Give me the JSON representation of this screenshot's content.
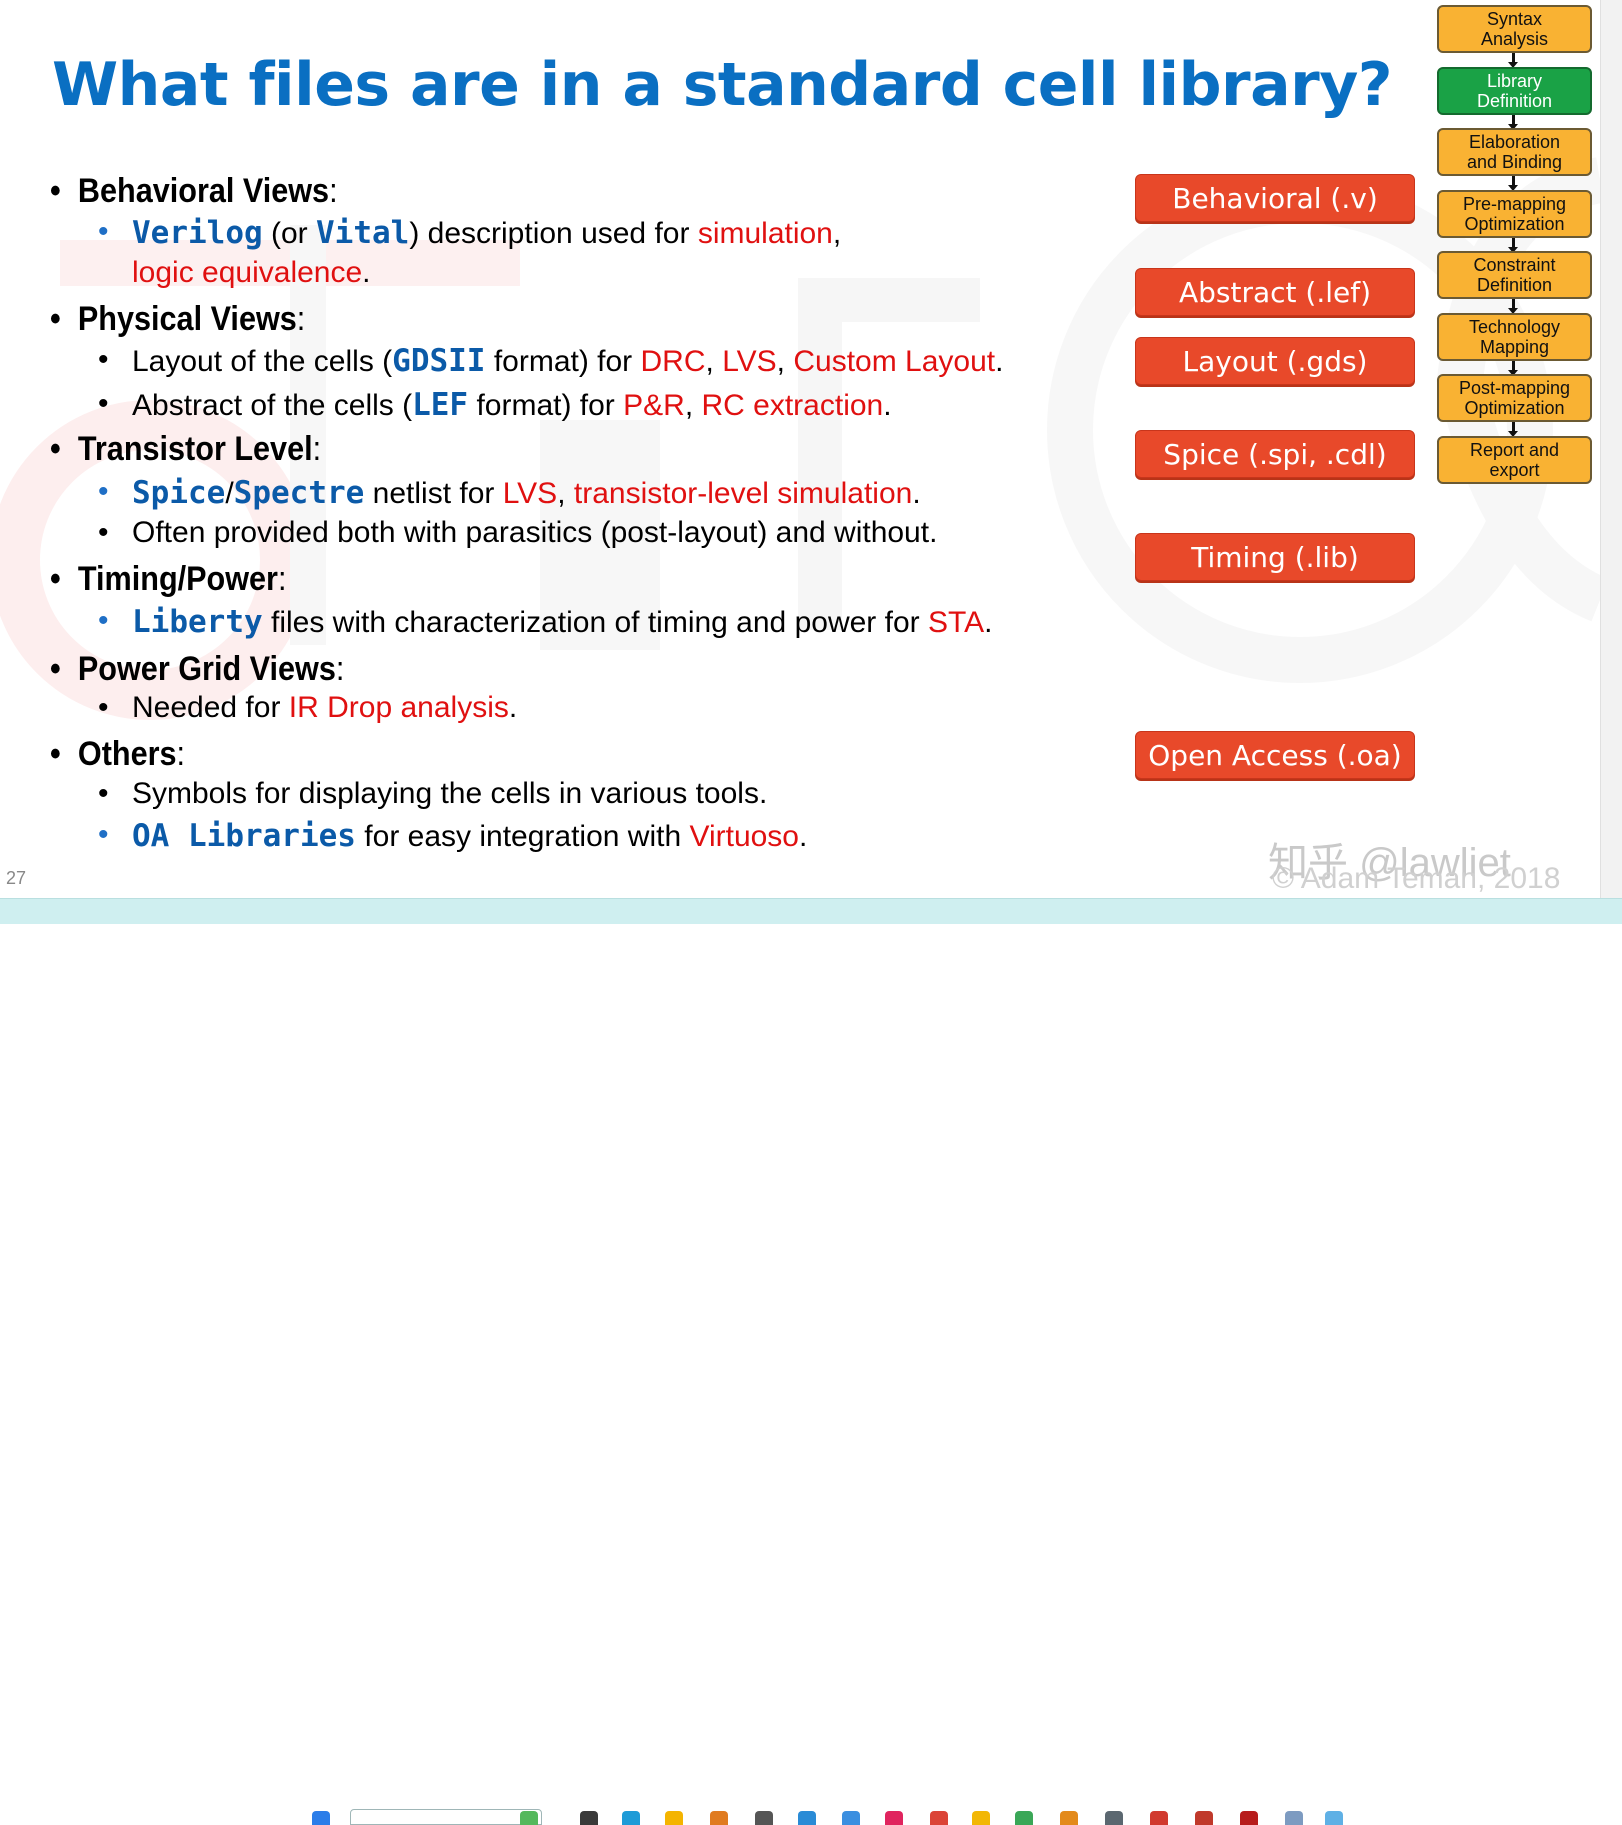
{
  "slide": {
    "title": "What files are in a standard cell library?",
    "bullets": [
      {
        "heading_text": "Behavioral Views",
        "heading_colon": ":",
        "subs": [
          {
            "bullet_blue": true,
            "runs": [
              {
                "text": "Verilog",
                "style": "mono"
              },
              {
                "text": " (or ",
                "style": "plain"
              },
              {
                "text": "Vital",
                "style": "mono"
              },
              {
                "text": ") description used for ",
                "style": "plain"
              },
              {
                "text": "simulation",
                "style": "red"
              },
              {
                "text": ",",
                "style": "plain"
              }
            ]
          },
          {
            "bullet_blue": false,
            "continuation": true,
            "runs": [
              {
                "text": "logic equivalence",
                "style": "red"
              },
              {
                "text": ".",
                "style": "plain"
              }
            ]
          }
        ]
      },
      {
        "heading_text": "Physical Views",
        "heading_colon": ":",
        "subs": [
          {
            "bullet_blue": false,
            "runs": [
              {
                "text": "Layout of the cells (",
                "style": "plain"
              },
              {
                "text": "GDSII",
                "style": "mono"
              },
              {
                "text": " format) for ",
                "style": "plain"
              },
              {
                "text": "DRC",
                "style": "red"
              },
              {
                "text": ", ",
                "style": "plain"
              },
              {
                "text": "LVS",
                "style": "red"
              },
              {
                "text": ", ",
                "style": "plain"
              },
              {
                "text": "Custom Layout",
                "style": "red"
              },
              {
                "text": ".",
                "style": "plain"
              }
            ]
          },
          {
            "bullet_blue": false,
            "runs": [
              {
                "text": "Abstract of the cells (",
                "style": "plain"
              },
              {
                "text": "LEF",
                "style": "mono"
              },
              {
                "text": " format) for ",
                "style": "plain"
              },
              {
                "text": "P&R",
                "style": "red"
              },
              {
                "text": ", ",
                "style": "plain"
              },
              {
                "text": "RC extraction",
                "style": "red"
              },
              {
                "text": ".",
                "style": "plain"
              }
            ]
          }
        ]
      },
      {
        "heading_text": "Transistor Level",
        "heading_colon": ":",
        "subs": [
          {
            "bullet_blue": true,
            "runs": [
              {
                "text": "Spice",
                "style": "mono"
              },
              {
                "text": "/",
                "style": "plain"
              },
              {
                "text": "Spectre",
                "style": "mono"
              },
              {
                "text": " netlist for ",
                "style": "plain"
              },
              {
                "text": "LVS",
                "style": "red"
              },
              {
                "text": ", ",
                "style": "plain"
              },
              {
                "text": "transistor-level simulation",
                "style": "red"
              },
              {
                "text": ".",
                "style": "plain"
              }
            ]
          },
          {
            "bullet_blue": false,
            "runs": [
              {
                "text": "Often provided both with parasitics (post-layout) and without.",
                "style": "plain"
              }
            ]
          }
        ]
      },
      {
        "heading_text": "Timing/Power",
        "heading_colon": ":",
        "subs": [
          {
            "bullet_blue": true,
            "runs": [
              {
                "text": "Liberty",
                "style": "mono"
              },
              {
                "text": " files with characterization of timing and power for ",
                "style": "plain"
              },
              {
                "text": "STA",
                "style": "red"
              },
              {
                "text": ".",
                "style": "plain"
              }
            ]
          }
        ]
      },
      {
        "heading_text": "Power Grid Views",
        "heading_colon": ":",
        "subs": [
          {
            "bullet_blue": false,
            "runs": [
              {
                "text": "Needed for ",
                "style": "plain"
              },
              {
                "text": "IR Drop analysis",
                "style": "red"
              },
              {
                "text": ".",
                "style": "plain"
              }
            ]
          }
        ]
      },
      {
        "heading_text": "Others",
        "heading_colon": ":",
        "subs": [
          {
            "bullet_blue": false,
            "runs": [
              {
                "text": "Symbols for displaying the cells in various tools.",
                "style": "plain"
              }
            ]
          },
          {
            "bullet_blue": true,
            "runs": [
              {
                "text": "OA Libraries",
                "style": "mono"
              },
              {
                "text": " for easy integration with ",
                "style": "plain"
              },
              {
                "text": "Virtuoso",
                "style": "red"
              },
              {
                "text": ".",
                "style": "plain"
              }
            ]
          }
        ]
      }
    ],
    "bullet_char": "•",
    "format_boxes": [
      "Behavioral (.v)",
      "Abstract (.lef)",
      "Layout (.gds)",
      "Spice (.spi, .cdl)",
      "Timing (.lib)",
      "Open Access (.oa)"
    ],
    "flow_steps": [
      {
        "label": "Syntax\nAnalysis",
        "active": false
      },
      {
        "label": "Library\nDefinition",
        "active": true
      },
      {
        "label": "Elaboration\nand Binding",
        "active": false
      },
      {
        "label": "Pre-mapping\nOptimization",
        "active": false
      },
      {
        "label": "Constraint\nDefinition",
        "active": false
      },
      {
        "label": "Technology\nMapping",
        "active": false
      },
      {
        "label": "Post-mapping\nOptimization",
        "active": false
      },
      {
        "label": "Report and\nexport",
        "active": false
      }
    ],
    "slide_number": "27",
    "copyright": "© Adam Teman, 2018",
    "zhihu_watermark": "知乎 @lawliet"
  },
  "colors": {
    "title_blue": "#0a6fc2",
    "mono_blue": "#0b5aa8",
    "red_text": "#e01010",
    "format_box": "#e8492a",
    "flow_box": "#f9b233",
    "flow_active": "#1aa246",
    "taskbar": "#cfeff0"
  }
}
